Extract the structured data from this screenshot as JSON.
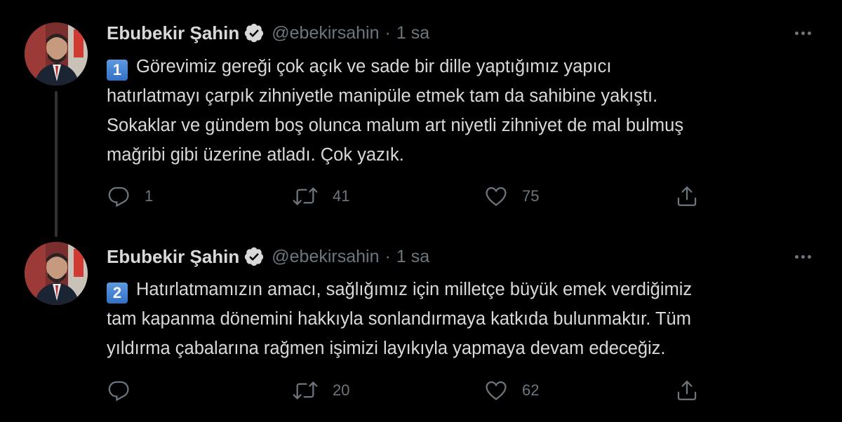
{
  "tweets": [
    {
      "author_name": "Ebubekir Şahin",
      "handle": "@ebekirsahin",
      "separator": "·",
      "time": "1 sa",
      "keycap": "1",
      "lines": [
        "Görevimiz gereği çok açık ve sade bir dille yaptığımız yapıcı",
        "hatırlatmayı çarpık zihniyetle manipüle etmek tam da sahibine yakıştı.",
        "Sokaklar ve gündem boş olunca malum art niyetli zihniyet de mal bulmuş",
        "mağribi gibi üzerine atladı. Çok yazık."
      ],
      "reply_count": "1",
      "retweet_count": "41",
      "like_count": "75"
    },
    {
      "author_name": "Ebubekir Şahin",
      "handle": "@ebekirsahin",
      "separator": "·",
      "time": "1 sa",
      "keycap": "2",
      "lines": [
        "Hatırlatmamızın amacı, sağlığımız için milletçe büyük emek verdiğimiz",
        "tam kapanma dönemini hakkıyla sonlandırmaya katkıda bulunmaktır. Tüm",
        "yıldırma çabalarına rağmen işimizi layıkıyla yapmaya devam edeceğiz."
      ],
      "reply_count": "",
      "retweet_count": "20",
      "like_count": "62"
    }
  ],
  "icons": {
    "avatar": "avatar-photo",
    "verified": "verified-badge-icon",
    "more": "more-options-icon",
    "reply": "reply-icon",
    "retweet": "retweet-icon",
    "like": "heart-icon",
    "share": "share-icon"
  },
  "colors": {
    "background": "#000000",
    "text": "#d9d9d9",
    "secondary_text": "#6e767d",
    "thread_line": "#2f3336",
    "keycap": "#3d7fd1"
  }
}
